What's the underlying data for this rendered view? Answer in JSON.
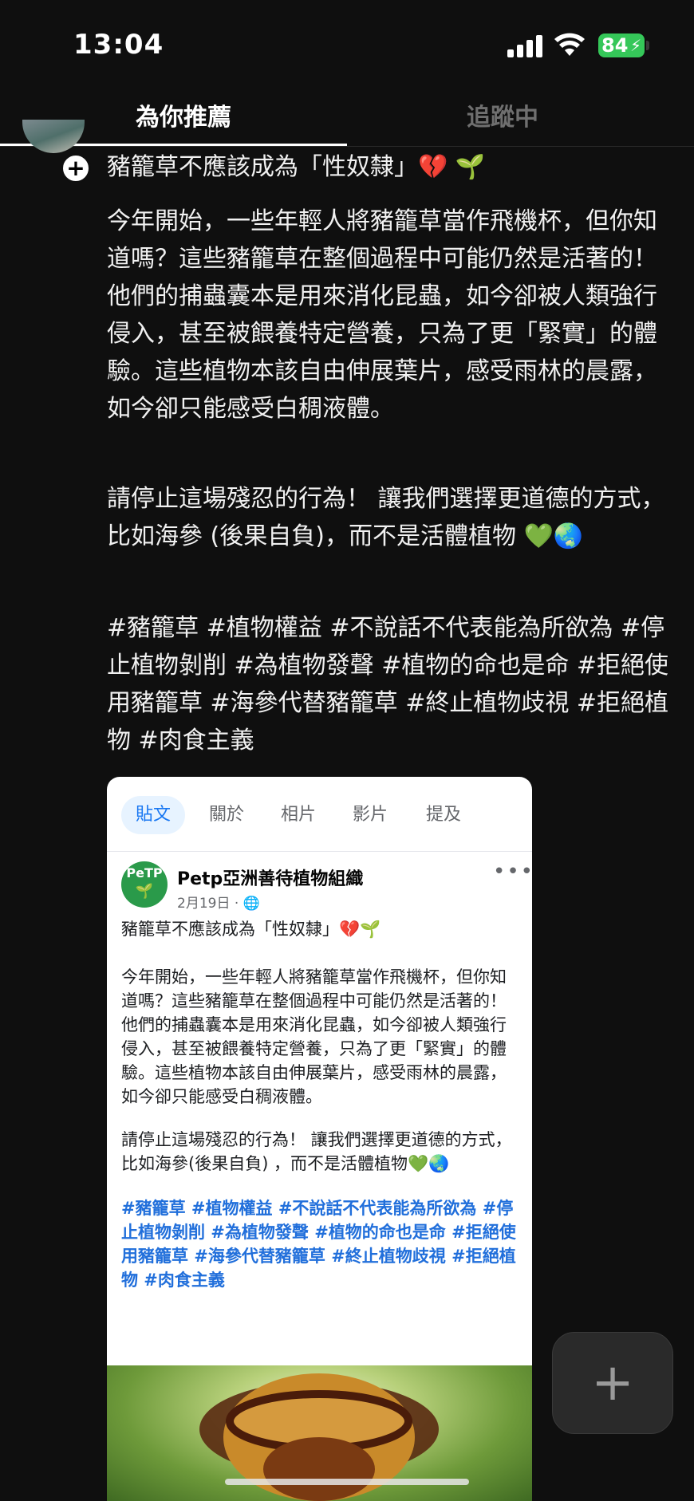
{
  "status_bar": {
    "time": "13:04",
    "battery": "84"
  },
  "tabs": [
    {
      "label": "為你推薦",
      "active": true
    },
    {
      "label": "追蹤中",
      "active": false
    }
  ],
  "post": {
    "title": "豬籠草不應該成為「性奴隸」💔 🌱",
    "body1": "今年開始，一些年輕人將豬籠草當作飛機杯，但你知道嗎？這些豬籠草在整個過程中可能仍然是活著的！他們的捕蟲囊本是用來消化昆蟲，如今卻被人類強行侵入，甚至被餵養特定營養，只為了更「緊實」的體驗。這些植物本該自由伸展葉片，感受雨林的晨露，如今卻只能感受白稠液體。",
    "body2": "請停止這場殘忍的行為！ 讓我們選擇更道德的方式，比如海參 (後果自負)，而不是活體植物 💚🌏",
    "tags": "#豬籠草 #植物權益 #不說話不代表能為所欲為 #停止植物剝削 #為植物發聲 #植物的命也是命 #拒絕使用豬籠草 #海參代替豬籠草 #終止植物歧視 #拒絕植物 #肉食主義"
  },
  "embed": {
    "tabs": [
      "貼文",
      "關於",
      "相片",
      "影片",
      "提及"
    ],
    "page_name": "Petp亞洲善待植物組織",
    "logo_text": "PeTP",
    "date": "2月19日 · 🌐",
    "text_title": "豬籠草不應該成為「性奴隸」💔🌱",
    "text_body1": "今年開始，一些年輕人將豬籠草當作飛機杯，但你知道嗎？這些豬籠草在整個過程中可能仍然是活著的！他們的捕蟲囊本是用來消化昆蟲，如今卻被人類強行侵入，甚至被餵養特定營養，只為了更「緊實」的體驗。這些植物本該自由伸展葉片，感受雨林的晨露，如今卻只能感受白稠液體。",
    "text_body2": "請停止這場殘忍的行為！ 讓我們選擇更道德的方式，比如海參(後果自負) ，而不是活體植物💚🌏",
    "tags": "#豬籠草 #植物權益 #不說話不代表能為所欲為 #停止植物剝削 #為植物發聲 #植物的命也是命 #拒絕使用豬籠草 #海參代替豬籠草 #終止植物歧視 #拒絕植物 #肉食主義"
  },
  "fab": {
    "icon": "plus-icon",
    "label": "+"
  },
  "colors": {
    "background": "#0f0f0f",
    "battery": "#35c759",
    "link": "#216fdb",
    "fb_tab_active": "#1877f2"
  }
}
